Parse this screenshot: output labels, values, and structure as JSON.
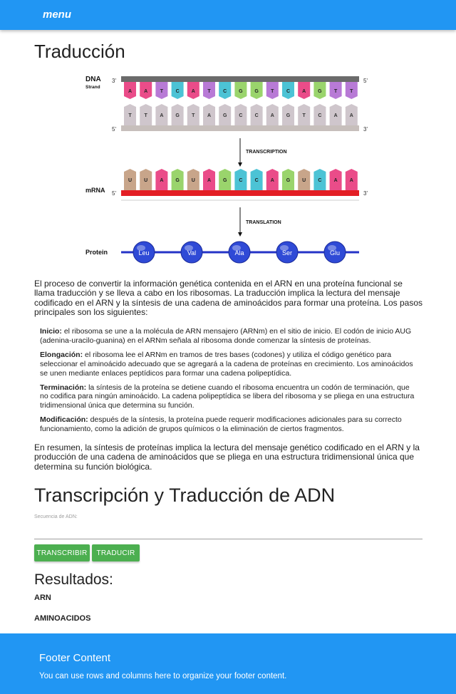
{
  "navbar": {
    "menu_label": "menu",
    "color": "#2196f3"
  },
  "page_title": "Traducción",
  "diagram": {
    "dna_label": "DNA",
    "strand_label": "Strand",
    "prime3": "3'",
    "prime5": "5'",
    "template_strand": [
      "A",
      "A",
      "T",
      "C",
      "A",
      "T",
      "C",
      "G",
      "G",
      "T",
      "C",
      "A",
      "G",
      "T",
      "T"
    ],
    "coding_strand": [
      "T",
      "T",
      "A",
      "G",
      "T",
      "A",
      "G",
      "C",
      "C",
      "A",
      "G",
      "T",
      "C",
      "A",
      "A"
    ],
    "transcription_label": "TRANSCRIPTION",
    "mrna_label": "mRNA",
    "mrna_strand": [
      "U",
      "U",
      "A",
      "G",
      "U",
      "A",
      "G",
      "C",
      "C",
      "A",
      "G",
      "U",
      "C",
      "A",
      "A"
    ],
    "translation_label": "TRANSLATION",
    "protein_label": "Protein",
    "amino_acids": [
      "Leu",
      "Val",
      "Ala",
      "Ser",
      "Glu"
    ],
    "base_colors": {
      "A": "#ea4c89",
      "T": "#d7d2e8",
      "U": "#c8a58a",
      "C": "#44c4d6",
      "G": "#9bd66a",
      "A_alt": "#b97ad6"
    }
  },
  "intro_text": "El proceso de convertir la información genética contenida en el ARN en una proteína funcional se llama traducción y se lleva a cabo en los ribosomas. La traducción implica la lectura del mensaje codificado en el ARN y la síntesis de una cadena de aminoácidos para formar una proteína. Los pasos principales son los siguientes:",
  "steps": [
    {
      "title": "Inicio:",
      "text": " el ribosoma se une a la molécula de ARN mensajero (ARNm) en el sitio de inicio. El codón de inicio AUG (adenina-uracilo-guanina) en el ARNm señala al ribosoma donde comenzar la síntesis de proteínas."
    },
    {
      "title": "Elongación:",
      "text": " el ribosoma lee el ARNm en tramos de tres bases (codones) y utiliza el código genético para seleccionar el aminoácido adecuado que se agregará a la cadena de proteínas en crecimiento. Los aminoácidos se unen mediante enlaces peptídicos para formar una cadena polipeptídica."
    },
    {
      "title": "Terminación:",
      "text": " la síntesis de la proteína se detiene cuando el ribosoma encuentra un codón de terminación, que no codifica para ningún aminoácido. La cadena polipeptídica se libera del ribosoma y se pliega en una estructura tridimensional única que determina su función."
    },
    {
      "title": "Modificación:",
      "text": " después de la síntesis, la proteína puede requerir modificaciones adicionales para su correcto funcionamiento, como la adición de grupos químicos o la eliminación de ciertos fragmentos."
    }
  ],
  "summary_text": "En resumen, la síntesis de proteínas implica la lectura del mensaje genético codificado en el ARN y la producción de una cadena de aminoácidos que se pliega en una estructura tridimensional única que determina su función biológica.",
  "tool": {
    "title": "Transcripción y Traducción de ADN",
    "input_label": "Secuencia de ADN:",
    "input_value": "",
    "transcribe_label": "TRANSCRIBIR",
    "translate_label": "TRADUCIR",
    "button_color": "#4caf50"
  },
  "results": {
    "heading": "Resultados:",
    "arn_label": "ARN",
    "amino_label": "AMINOACIDOS"
  },
  "footer": {
    "title": "Footer Content",
    "text": "You can use rows and columns here to organize your footer content."
  }
}
